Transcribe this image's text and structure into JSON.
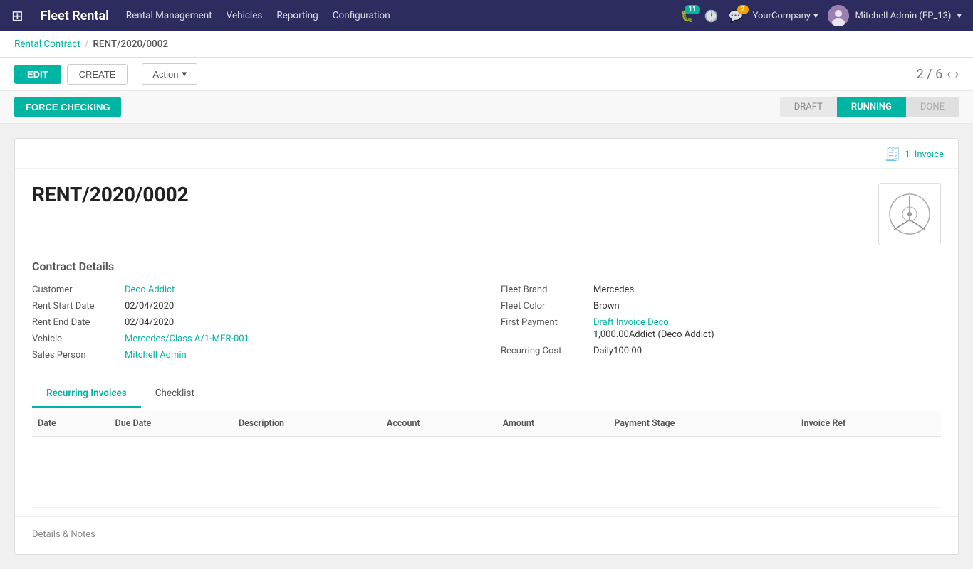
{
  "app": {
    "brand": "Fleet Rental",
    "nav_links": [
      "Rental Management",
      "Vehicles",
      "Reporting",
      "Configuration"
    ],
    "notifications": {
      "bug_count": 11,
      "chat_count": 2
    },
    "company": "YourCompany",
    "user": "Mitchell Admin (EP_13)"
  },
  "breadcrumb": {
    "parent": "Rental Contract",
    "separator": "/",
    "current": "RENT/2020/0002"
  },
  "toolbar": {
    "edit_label": "EDIT",
    "create_label": "CREATE",
    "action_label": "Action",
    "nav_position": "2 / 6"
  },
  "status_bar": {
    "force_checking_label": "FORCE CHECKING",
    "steps": [
      "DRAFT",
      "RUNNING",
      "DONE"
    ],
    "active_step": "RUNNING"
  },
  "invoice_badge": {
    "count": "1",
    "label": "Invoice"
  },
  "contract": {
    "title": "RENT/2020/0002",
    "details_heading": "Contract Details",
    "fields": {
      "customer_label": "Customer",
      "customer_value": "Deco Addict",
      "rent_start_label": "Rent Start Date",
      "rent_start_value": "02/04/2020",
      "rent_end_label": "Rent End Date",
      "rent_end_value": "02/04/2020",
      "vehicle_label": "Vehicle",
      "vehicle_value": "Mercedes/Class A/1-MER-001",
      "sales_person_label": "Sales Person",
      "sales_person_value": "Mitchell Admin",
      "fleet_brand_label": "Fleet Brand",
      "fleet_brand_value": "Mercedes",
      "fleet_color_label": "Fleet Color",
      "fleet_color_value": "Brown",
      "first_payment_label": "First Payment",
      "first_payment_line1": "Draft Invoice Deco",
      "first_payment_line2": "1,000.00Addict (Deco Addict)",
      "recurring_cost_label": "Recurring Cost",
      "recurring_cost_value": "Daily100.00"
    }
  },
  "tabs": {
    "items": [
      "Recurring Invoices",
      "Checklist"
    ],
    "active": "Recurring Invoices"
  },
  "table": {
    "columns": [
      "Date",
      "Due Date",
      "Description",
      "Account",
      "Amount",
      "Payment Stage",
      "Invoice Ref"
    ],
    "rows": []
  },
  "details_notes": {
    "label": "Details & Notes"
  }
}
